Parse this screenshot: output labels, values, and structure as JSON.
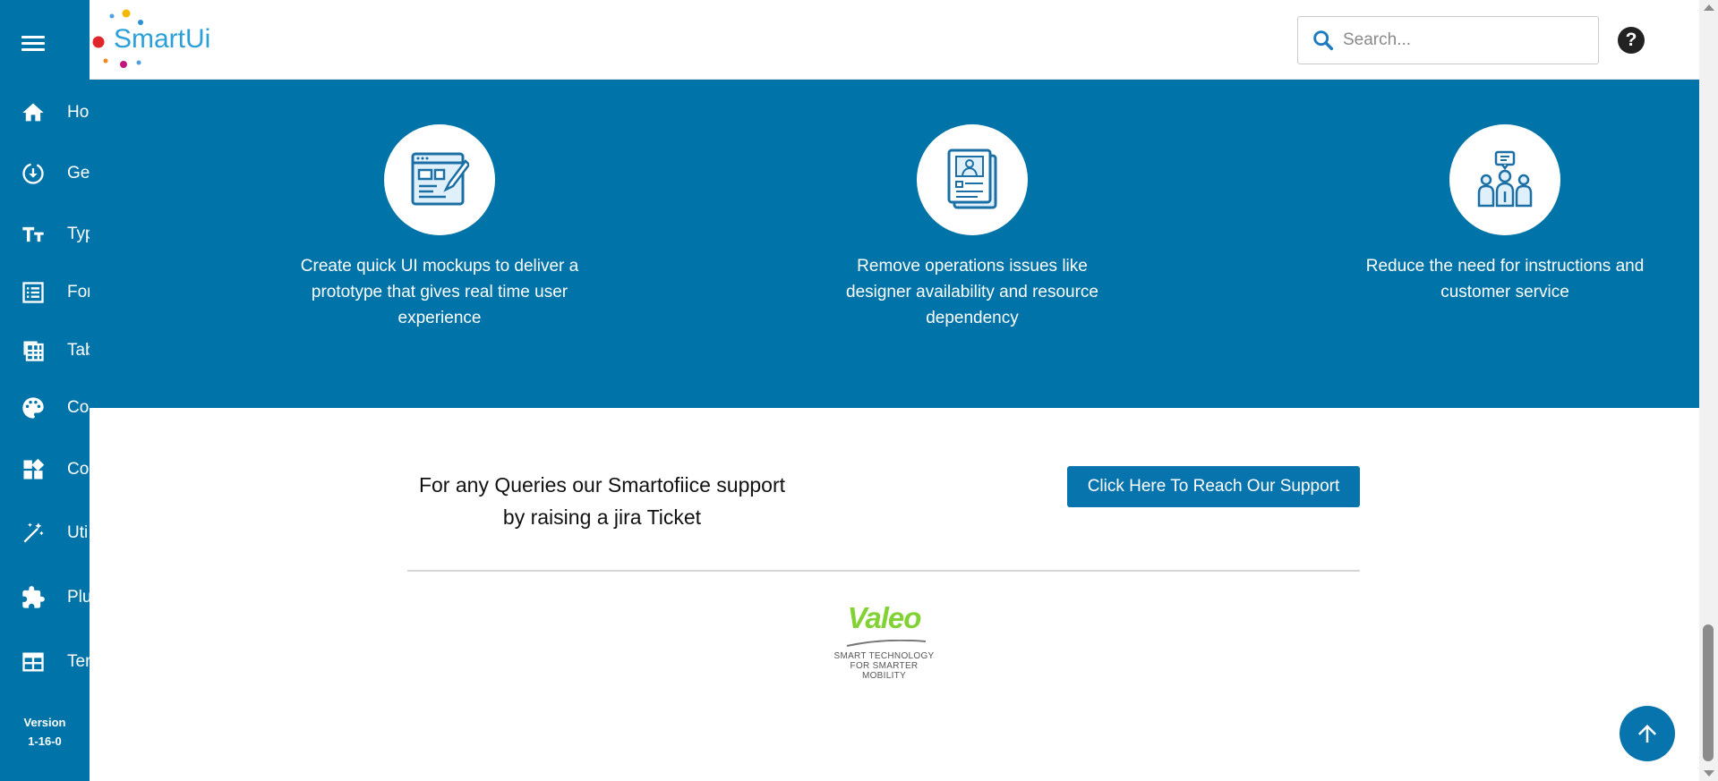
{
  "app": {
    "logo_text": "SmartUi"
  },
  "sidebar": {
    "items": [
      {
        "label": "Ho",
        "icon": "home-icon"
      },
      {
        "label": "Ge",
        "icon": "download-icon"
      },
      {
        "label": "Typ",
        "icon": "typography-icon"
      },
      {
        "label": "For",
        "icon": "form-icon"
      },
      {
        "label": "Tab",
        "icon": "table-icon"
      },
      {
        "label": "Co",
        "icon": "palette-icon"
      },
      {
        "label": "Co",
        "icon": "widgets-icon"
      },
      {
        "label": "Uti",
        "icon": "magic-wand-icon"
      },
      {
        "label": "Plu",
        "icon": "puzzle-icon"
      },
      {
        "label": "Ter",
        "icon": "template-icon"
      }
    ],
    "version_label": "Version",
    "version_value": "1-16-0"
  },
  "header": {
    "search_placeholder": "Search...",
    "help_label": "?"
  },
  "features": [
    {
      "text": "Create quick UI mockups to deliver a prototype that gives real time user experience",
      "icon": "design-mockup-icon"
    },
    {
      "text": "Remove operations issues like designer availability and resource dependency",
      "icon": "resume-document-icon"
    },
    {
      "text": "Reduce the need for instructions and customer service",
      "icon": "team-support-icon"
    }
  ],
  "support": {
    "text": "For any Queries our Smartofiice support by raising a jira Ticket",
    "button_label": "Click Here To Reach Our Support"
  },
  "footer": {
    "brand": "Valeo",
    "tagline_line1": "SMART TECHNOLOGY",
    "tagline_line2": "FOR SMARTER MOBILITY"
  },
  "colors": {
    "primary": "#0074a8",
    "button": "#0874ad",
    "valeo_green": "#82d235"
  }
}
